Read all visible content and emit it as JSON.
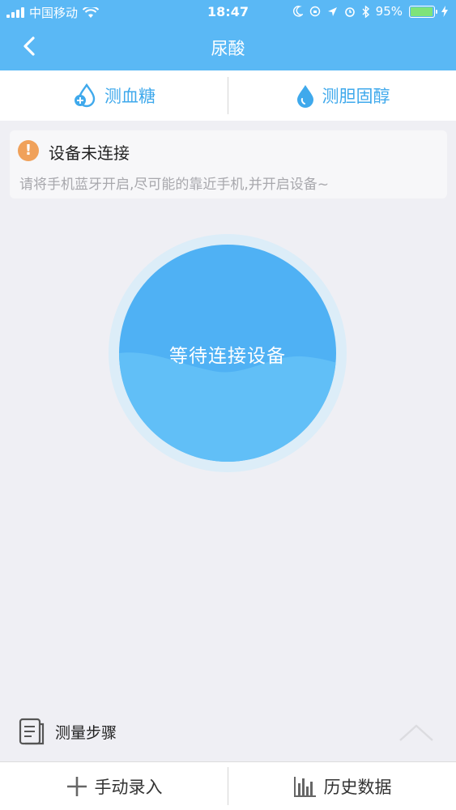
{
  "status_bar": {
    "carrier": "中国移动",
    "time": "18:47",
    "battery_percent": "95%",
    "battery_level": 0.95
  },
  "nav": {
    "title": "尿酸"
  },
  "tabs": [
    {
      "label": "测血糖",
      "icon": "blood-drop-plus-icon"
    },
    {
      "label": "测胆固醇",
      "icon": "water-drop-icon"
    }
  ],
  "alert": {
    "title": "设备未连接",
    "description": "请将手机蓝牙开启,尽可能的靠近手机,并开启设备~"
  },
  "device_circle": {
    "label": "等待连接设备"
  },
  "steps": {
    "label": "测量步骤"
  },
  "bottom_bar": {
    "manual_label": "手动录入",
    "history_label": "历史数据"
  },
  "colors": {
    "primary": "#5ab8f5",
    "accent_text": "#3fa9ec",
    "warning": "#f0a15a",
    "background": "#efeff4"
  }
}
